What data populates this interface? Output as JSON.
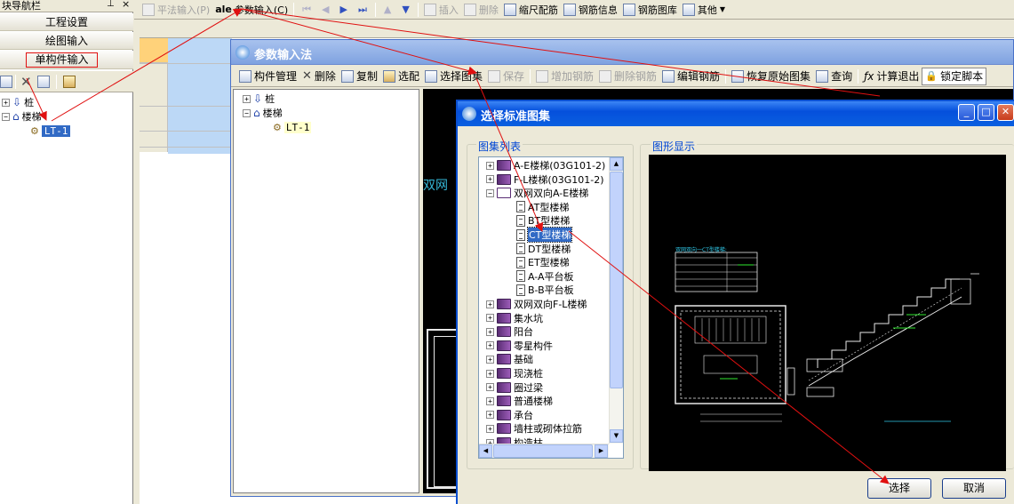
{
  "nav_panel": {
    "title": "块导航栏",
    "items": [
      "工程设置",
      "绘图输入",
      "单构件输入"
    ],
    "tree": [
      {
        "label": "桩"
      },
      {
        "label": "楼梯"
      },
      {
        "label": "LT-1"
      }
    ]
  },
  "top_toolbar": {
    "items": [
      {
        "label": "平法输入(P)"
      },
      {
        "label": "参数输入(C)"
      },
      {
        "label": "插入"
      },
      {
        "label": "删除"
      },
      {
        "label": "缩尺配筋"
      },
      {
        "label": "钢筋信息"
      },
      {
        "label": "钢筋图库"
      },
      {
        "label": "其他"
      }
    ]
  },
  "param_window": {
    "title": "参数输入法",
    "toolbar": [
      {
        "label": "构件管理"
      },
      {
        "label": "删除"
      },
      {
        "label": "复制"
      },
      {
        "label": "选配"
      },
      {
        "label": "选择图集"
      },
      {
        "label": "保存"
      },
      {
        "label": "增加钢筋"
      },
      {
        "label": "删除钢筋"
      },
      {
        "label": "编辑钢筋"
      },
      {
        "label": "恢复原始图集"
      },
      {
        "label": "查询"
      },
      {
        "label": "计算退出"
      },
      {
        "label": "锁定脚本"
      }
    ],
    "tree": [
      {
        "label": "桩"
      },
      {
        "label": "楼梯"
      },
      {
        "label": "LT-1"
      }
    ],
    "canvas_text": "双网"
  },
  "dialog": {
    "title": "选择标准图集",
    "list_label": "图集列表",
    "preview_label": "图形显示",
    "tree": [
      {
        "label": "A-E楼梯(03G101-2)"
      },
      {
        "label": "F-L楼梯(03G101-2)"
      },
      {
        "label": "双网双向A-E楼梯"
      },
      {
        "label": "AT型楼梯"
      },
      {
        "label": "BT型楼梯"
      },
      {
        "label": "CT型楼梯"
      },
      {
        "label": "DT型楼梯"
      },
      {
        "label": "ET型楼梯"
      },
      {
        "label": "A-A平台板"
      },
      {
        "label": "B-B平台板"
      },
      {
        "label": "双网双向F-L楼梯"
      },
      {
        "label": "集水坑"
      },
      {
        "label": "阳台"
      },
      {
        "label": "零星构件"
      },
      {
        "label": "基础"
      },
      {
        "label": "现浇桩"
      },
      {
        "label": "圈过梁"
      },
      {
        "label": "普通楼梯"
      },
      {
        "label": "承台"
      },
      {
        "label": "墙柱或砌体拉筋"
      },
      {
        "label": "构造柱"
      }
    ],
    "preview_title": "双网双向一CT型楼梯:",
    "select_button": "选择",
    "cancel_button": "取消"
  },
  "colors": {
    "xp_title": "#0a5fe0",
    "annotation": "#e01010",
    "selection": "#316ac5"
  }
}
